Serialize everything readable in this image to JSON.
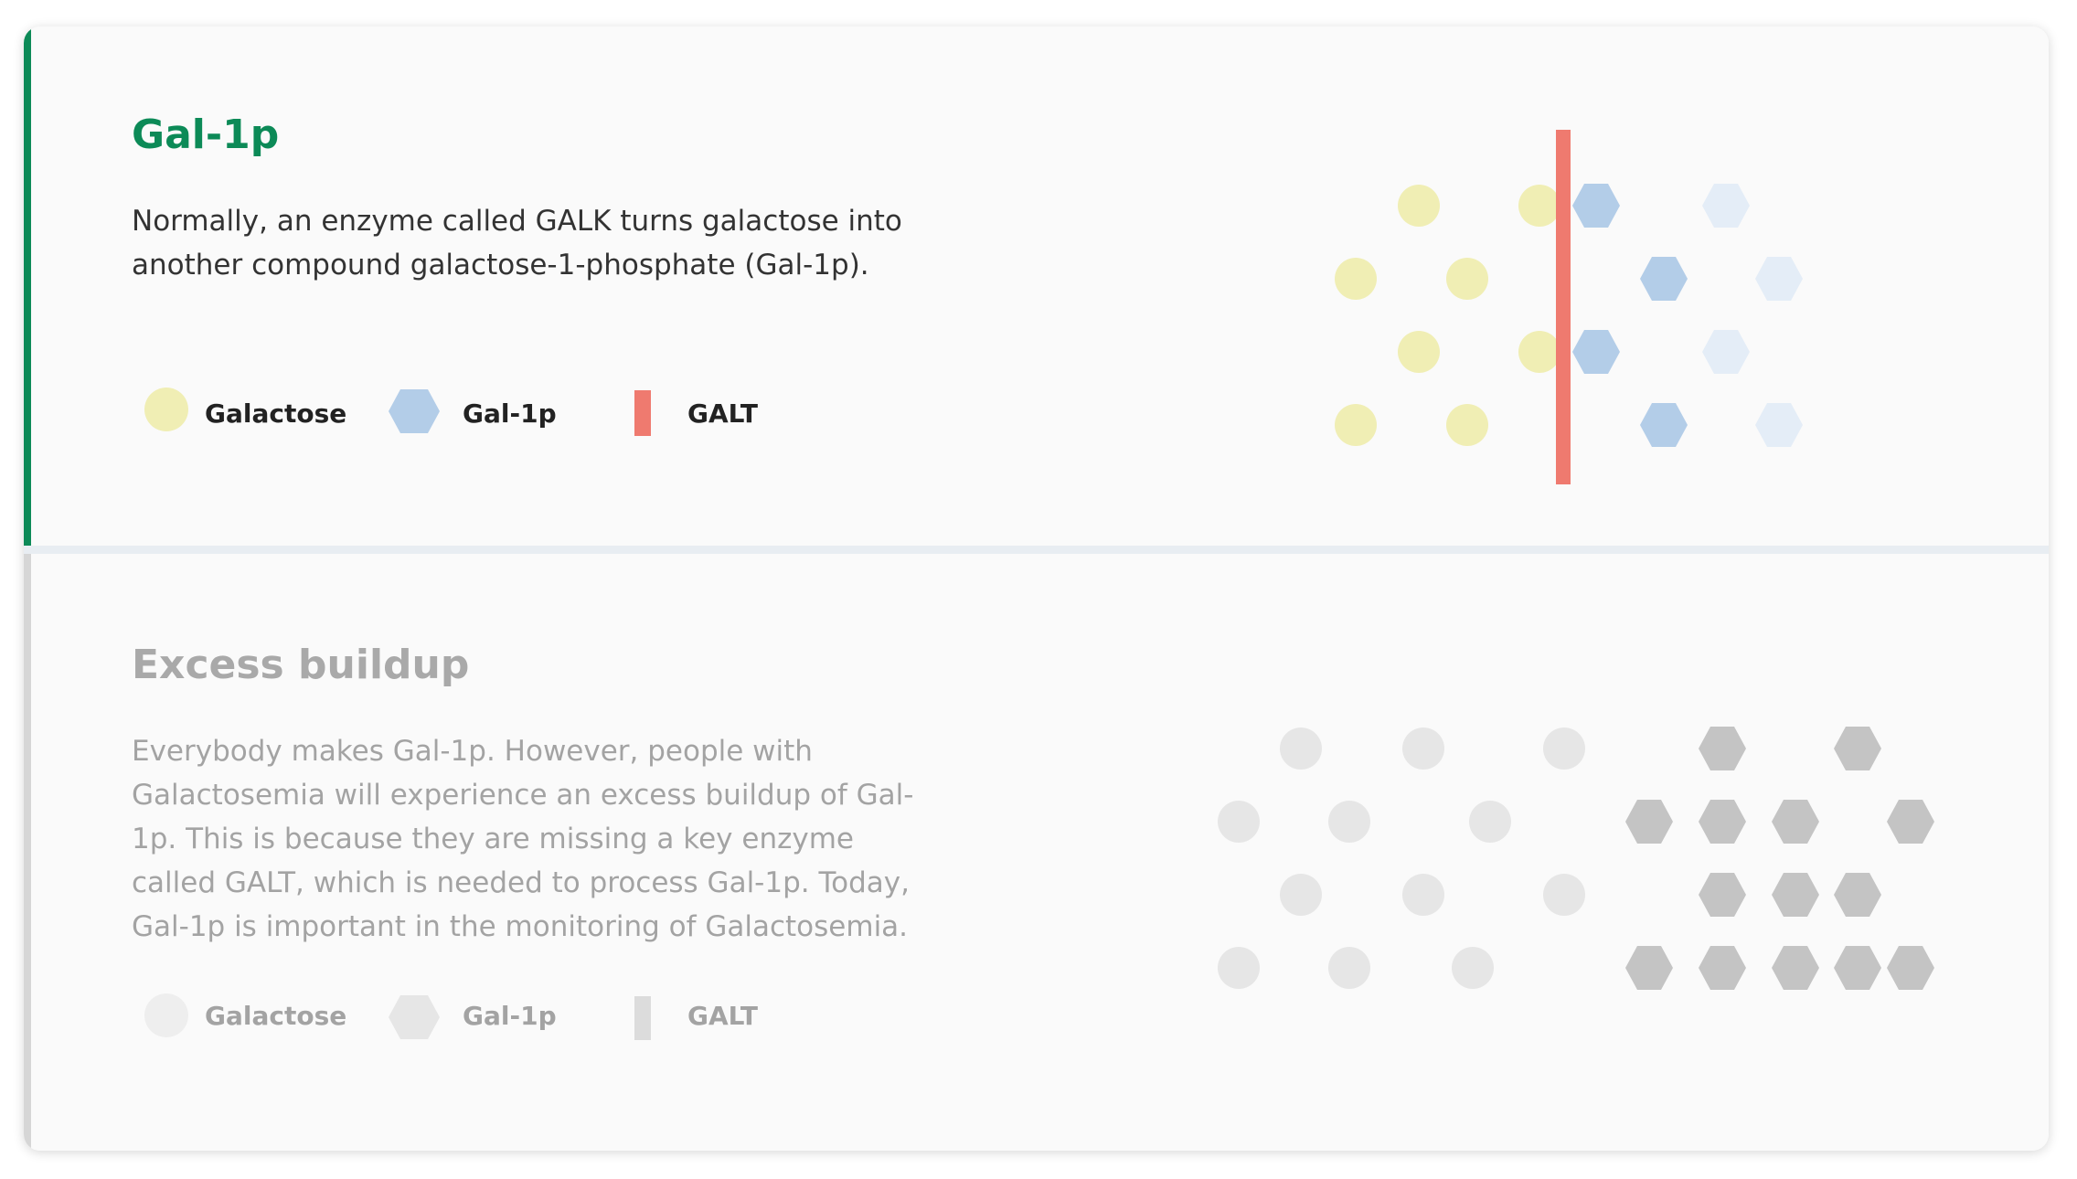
{
  "sections": [
    {
      "title": "Gal-1p",
      "description": "Normally, an enzyme called GALK turns galactose into another compound galactose-1-phosphate (Gal-1p).",
      "legend": [
        {
          "label": "Galactose",
          "shape": "circle",
          "color": "#f0eeb4"
        },
        {
          "label": "Gal-1p",
          "shape": "hexagon",
          "color": "#b3cde8"
        },
        {
          "label": "GALT",
          "shape": "bar",
          "color": "#ef7a6f"
        }
      ]
    },
    {
      "title": "Excess buildup",
      "description": "Everybody makes Gal-1p. However, people with Galactosemia will experience an excess buildup of Gal-1p. This is because they are missing a key enzyme called GALT, which is needed to process Gal-1p. Today, Gal-1p is important in the monitoring of Galactosemia.",
      "legend": [
        {
          "label": "Galactose",
          "shape": "circle",
          "color": "#eeeeee"
        },
        {
          "label": "Gal-1p",
          "shape": "hexagon",
          "color": "#e6e6e6"
        },
        {
          "label": "GALT",
          "shape": "bar",
          "color": "#dcdcdc"
        }
      ]
    }
  ],
  "colors": {
    "accent": "#0c8a57",
    "galactose": "#f0eeb4",
    "gal1p": "#b3cde8",
    "gal1p_faded": "#e4edf7",
    "galt": "#ef7a6f",
    "grey_circle": "#e6e6e6",
    "grey_hexagon": "#c4c4c4"
  }
}
